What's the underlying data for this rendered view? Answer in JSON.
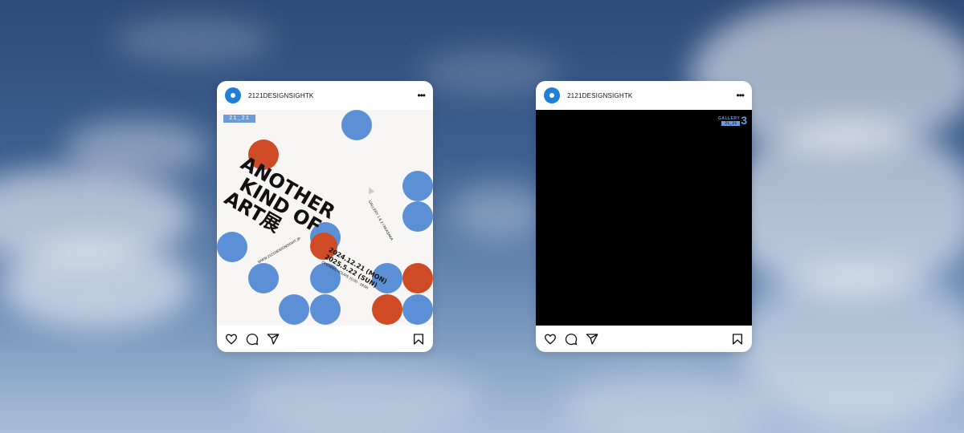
{
  "posts": [
    {
      "username": "2121DESIGNSIGHTK",
      "more_label": "•••",
      "poster": {
        "tag": "21_21",
        "title_lines": [
          "ANOTHER",
          "KIND OF",
          "ART展"
        ],
        "dates": [
          "2024.12.21 (MON)",
          "2025.5.22 (SUN)"
        ],
        "hours": "OPENING HOURS 10:00 - 19:00",
        "url": "WWW.2121DESIGNSIGHT.JP",
        "gallery_side": "GALLERY 1 & 2 / AKASAKA"
      }
    },
    {
      "username": "2121DESIGNSIGHTK",
      "more_label": "•••",
      "gallery_badge": {
        "word": "GALLERY",
        "pill": "21_21",
        "number": "3"
      }
    }
  ],
  "icons": [
    "heart-icon",
    "comment-icon",
    "share-icon",
    "bookmark-icon"
  ],
  "colors": {
    "avatar": "#1f7fd6",
    "dot_blue": "#5b8fd6",
    "dot_red": "#cf4b25",
    "video_bg": "#000000"
  }
}
